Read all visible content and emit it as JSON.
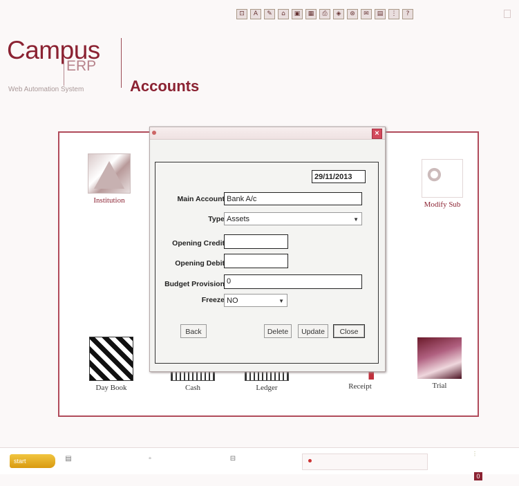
{
  "toolbar": {
    "icons": [
      "select-icon",
      "text-icon",
      "highlight-icon",
      "stamp-icon",
      "image-icon",
      "table-icon",
      "print-icon",
      "shapes-icon",
      "link-icon",
      "comment-icon",
      "save-icon",
      "grid-icon",
      "help-icon"
    ],
    "glyphs": [
      "⊡",
      "A",
      "✎",
      "⌂",
      "▣",
      "▦",
      "⎙",
      "◈",
      "⊛",
      "✉",
      "▤",
      "⋮",
      "?"
    ]
  },
  "brand": {
    "name": "Campus",
    "suffix": "ERP",
    "tagline": "Web Automation System"
  },
  "module_title": "Accounts",
  "tiles": {
    "institution": "Institution",
    "modify_sub": "Modify Sub",
    "day_book": "Day Book",
    "cash": "Cash",
    "ledger": "Ledger",
    "receipt": "Receipt",
    "trial": "Trial"
  },
  "dialog": {
    "date": "29/11/2013",
    "fields": {
      "main_account_label": "Main Account",
      "main_account_value": "Bank A/c",
      "type_label": "Type",
      "type_value": "Assets",
      "opening_credit_label": "Opening Credit",
      "opening_credit_value": "",
      "opening_debit_label": "Opening Debit",
      "opening_debit_value": "",
      "budget_provision_label": "Budget Provision",
      "budget_provision_value": "0",
      "freeze_label": "Freeze",
      "freeze_value": "NO"
    },
    "buttons": {
      "back": "Back",
      "delete": "Delete",
      "update": "Update",
      "close": "Close"
    },
    "close_glyph": "×"
  },
  "taskbar": {
    "start_label": "start",
    "tray_badge": "0"
  },
  "colors": {
    "brand": "#8b2232",
    "panel_border": "#b04a5a",
    "dialog_bg": "#f3f3f1"
  }
}
